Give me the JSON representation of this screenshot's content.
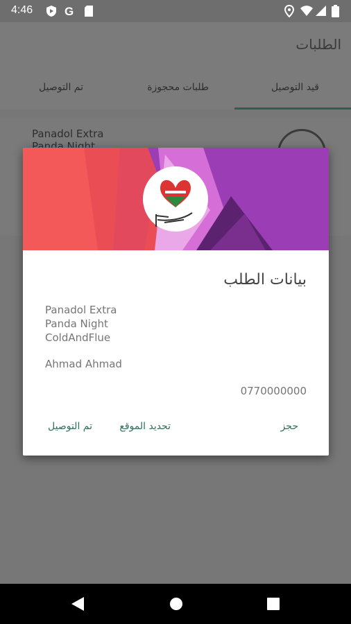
{
  "status_bar": {
    "time": "4:46"
  },
  "app_bar": {
    "title": "الطلبات"
  },
  "tabs": [
    {
      "label": "قيد التوصيل",
      "active": true
    },
    {
      "label": "طلبات محجوزة",
      "active": false
    },
    {
      "label": "تم التوصيل",
      "active": false
    }
  ],
  "background_list": {
    "item_text": "Panadol Extra\nPanda Night"
  },
  "dialog": {
    "title": "بيانات الطلب",
    "items": [
      "Panadol Extra",
      "Panda Night",
      "ColdAndFlue"
    ],
    "customer_name": "Ahmad Ahmad",
    "phone": "0770000000",
    "actions": {
      "reserve": "حجز",
      "update_location": "تحديد الموقع",
      "delivered": "تم التوصيل"
    }
  },
  "colors": {
    "accent": "#2f6d5b",
    "banner_red": "#f0504f",
    "banner_purple": "#9b3db5"
  }
}
